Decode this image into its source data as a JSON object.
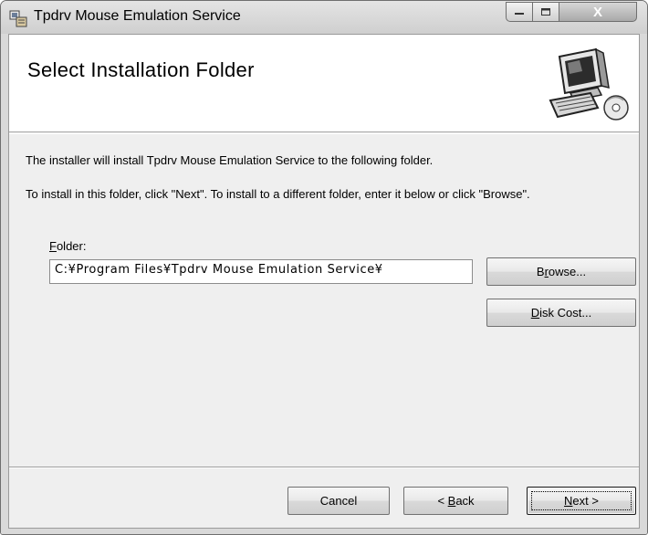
{
  "window": {
    "title": "Tpdrv Mouse Emulation Service",
    "minimize_icon": "minimize-icon",
    "maximize_icon": "maximize-icon",
    "close_icon": "close-icon",
    "close_glyph": "X",
    "minimize_glyph": "—",
    "maximize_glyph": "□"
  },
  "banner": {
    "title": "Select Installation Folder",
    "icon": "computer-with-disc-icon"
  },
  "body": {
    "line1": "The installer will install Tpdrv Mouse Emulation Service to the following folder.",
    "line2": "To install in this folder, click \"Next\". To install to a different folder, enter it below or click \"Browse\"."
  },
  "folder": {
    "label_accel": "F",
    "label_rest": "older:",
    "value": "C:¥Program Files¥Tpdrv Mouse Emulation Service¥"
  },
  "buttons": {
    "browse": {
      "pre": "B",
      "accel": "r",
      "post": "owse..."
    },
    "disk_cost": {
      "pre": "",
      "accel": "D",
      "post": "isk Cost..."
    },
    "cancel": {
      "label": "Cancel"
    },
    "back": {
      "pre": "< ",
      "accel": "B",
      "post": "ack"
    },
    "next": {
      "pre": "",
      "accel": "N",
      "post": "ext >"
    }
  }
}
